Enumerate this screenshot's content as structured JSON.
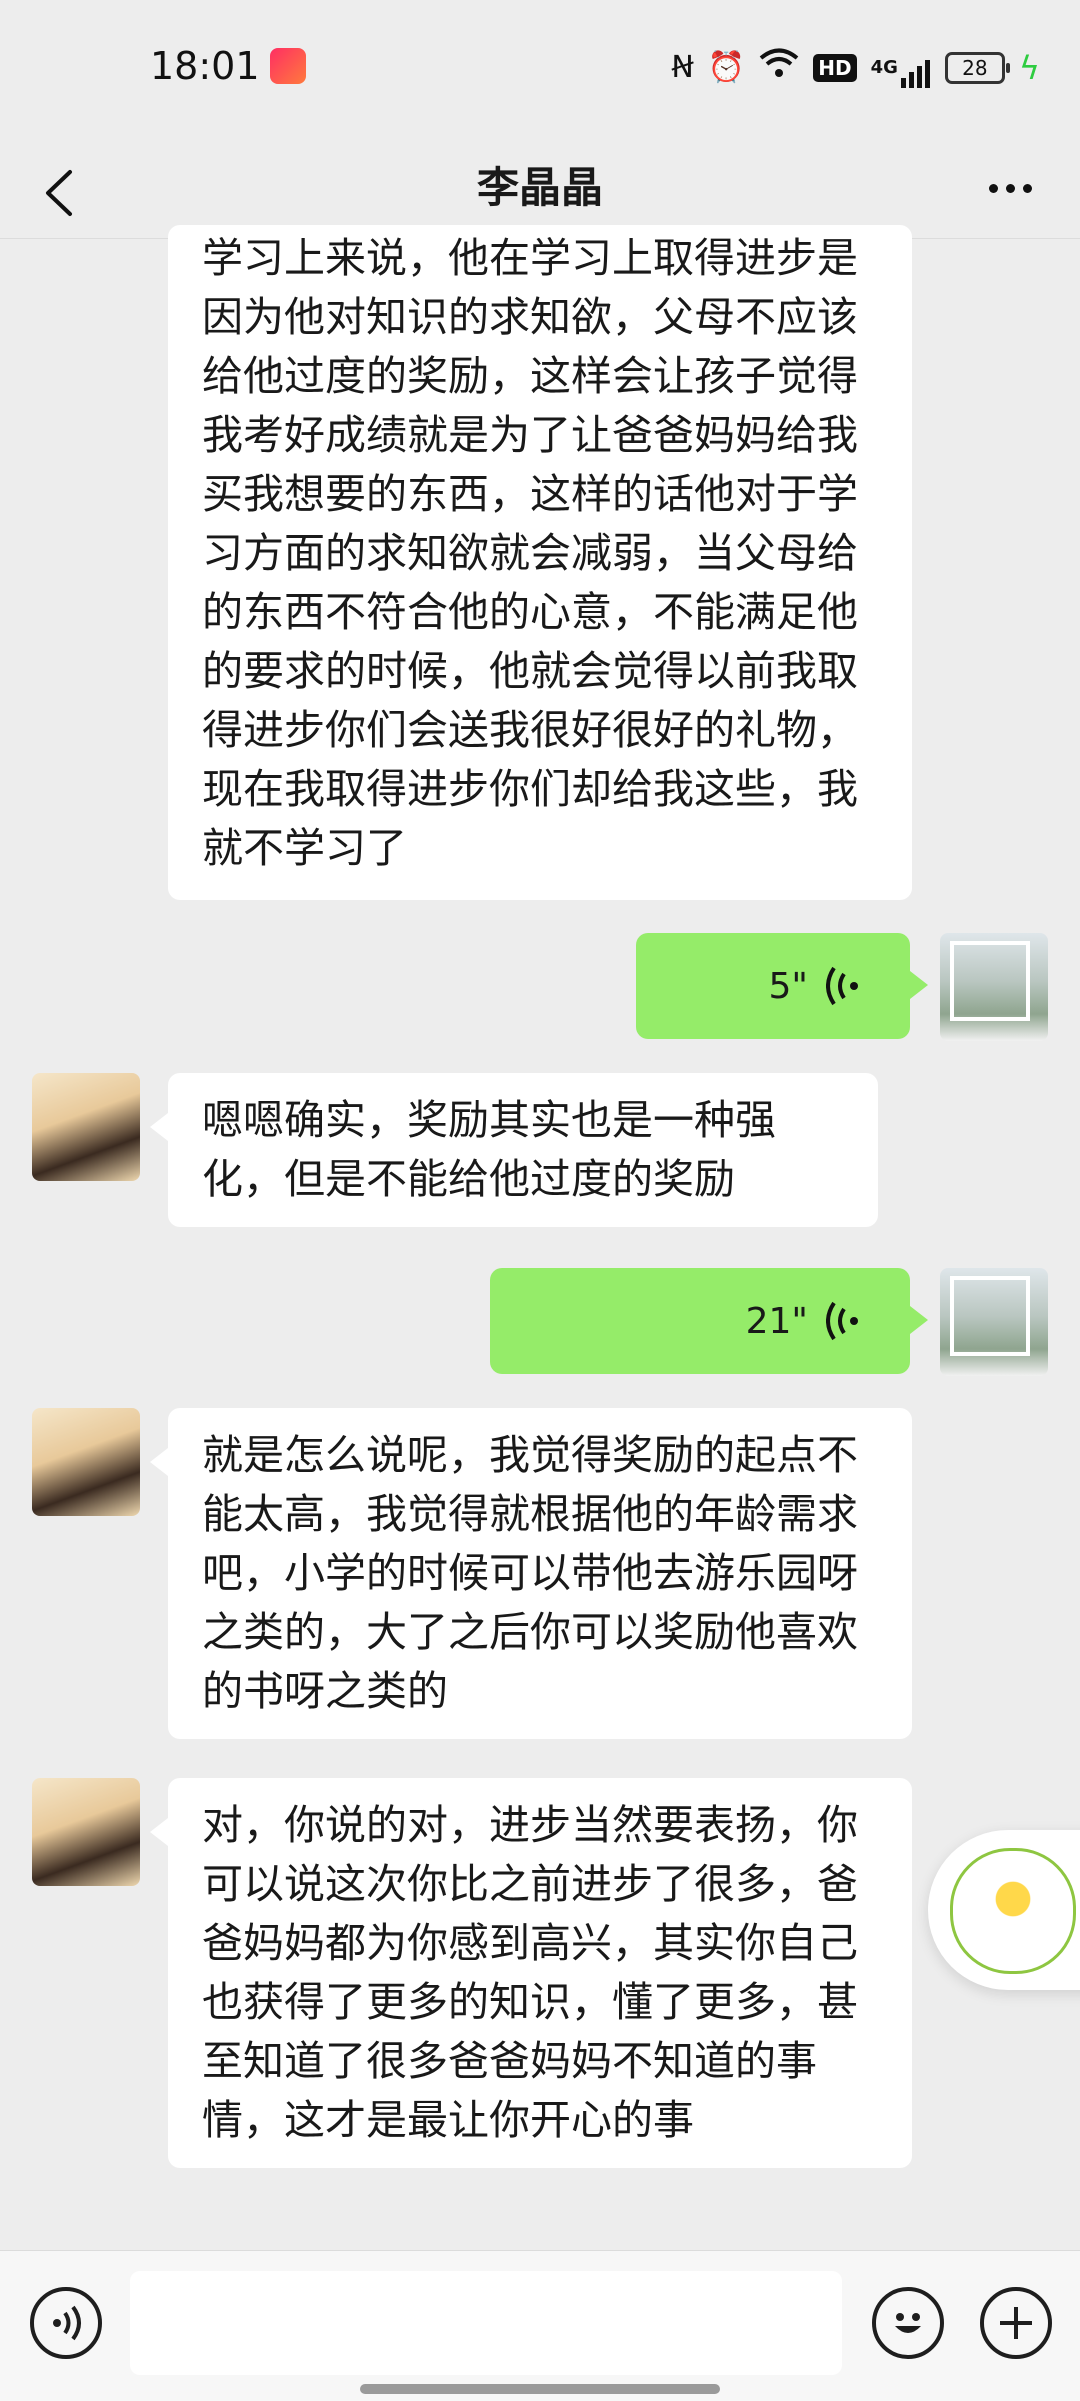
{
  "status_bar": {
    "time": "18:01",
    "battery": "28",
    "network": "4G",
    "hd": "HD"
  },
  "nav": {
    "title": "李晶晶"
  },
  "messages": {
    "m1": "学习上来说，他在学习上取得进步是因为他对知识的求知欲，父母不应该给他过度的奖励，这样会让孩子觉得我考好成绩就是为了让爸爸妈妈给我买我想要的东西，这样的话他对于学习方面的求知欲就会减弱，当父母给的东西不符合他的心意，不能满足他的要求的时候，他就会觉得以前我取得进步你们会送我很好很好的礼物，现在我取得进步你们却给我这些，我就不学习了",
    "v1": "5\"",
    "m2": "嗯嗯确实，奖励其实也是一种强化，但是不能给他过度的奖励",
    "v2": "21\"",
    "m3": "就是怎么说呢，我觉得奖励的起点不能太高，我觉得就根据他的年龄需求吧，小学的时候可以带他去游乐园呀之类的，大了之后你可以奖励他喜欢的书呀之类的",
    "m4": "对，你说的对，进步当然要表扬，你可以说这次你比之前进步了很多，爸爸妈妈都为你感到高兴，其实你自己也获得了更多的知识，懂了更多，甚至知道了很多爸爸妈妈不知道的事情，这才是最让你开心的事"
  },
  "icons": {
    "back": "chevron-left",
    "more": "more-dots",
    "voice_mode": "voice-icon",
    "emoji": "emoji-icon",
    "plus": "plus-icon"
  },
  "colors": {
    "background": "#ededed",
    "sent_bubble": "#95ec69",
    "received_bubble": "#ffffff"
  }
}
